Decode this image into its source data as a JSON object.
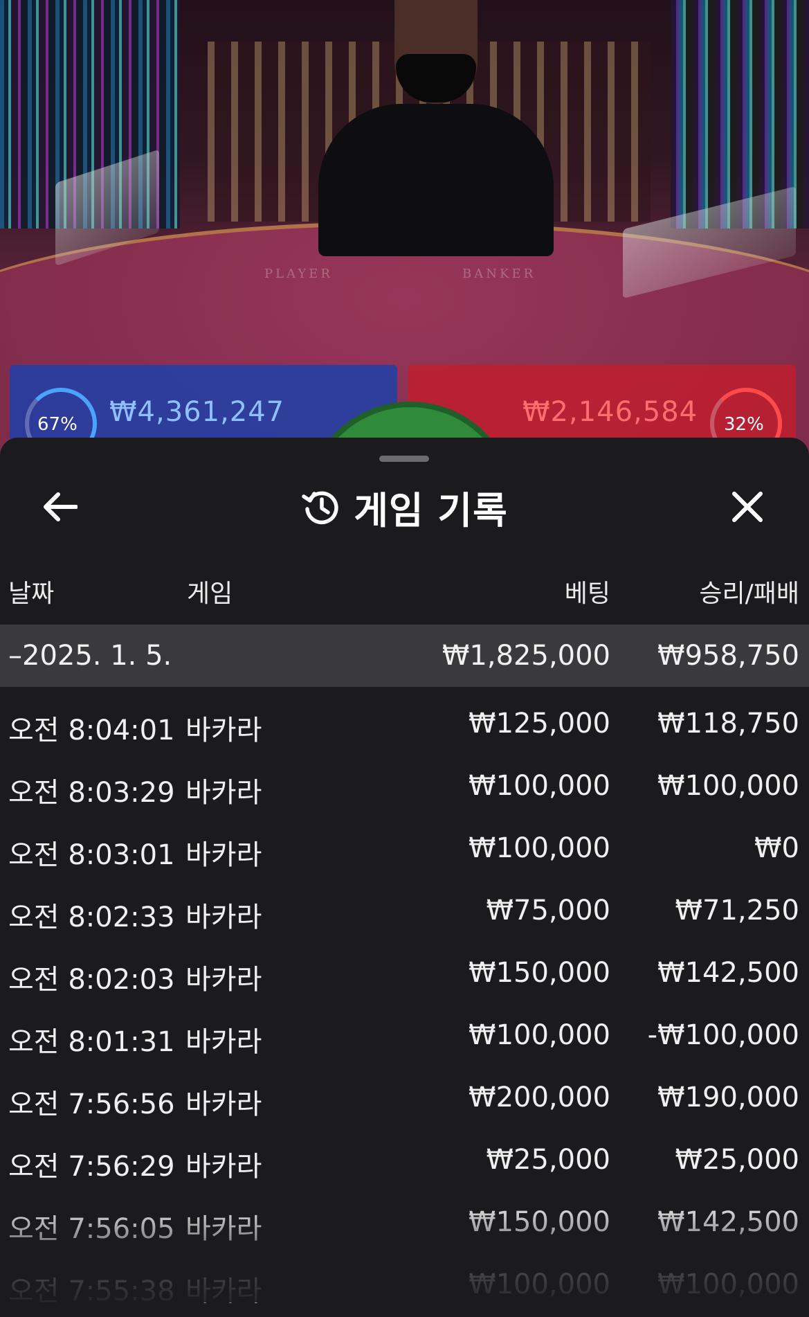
{
  "video": {
    "felt_player_text": "PLAYER",
    "felt_banker_text": "BANKER",
    "player": {
      "percent": "67%",
      "amount": "₩4,361,247"
    },
    "banker": {
      "percent": "32%",
      "amount": "₩2,146,584"
    }
  },
  "sheet": {
    "title": "게임 기록",
    "icons": {
      "back": "arrow-left-icon",
      "history": "history-icon",
      "close": "close-icon"
    }
  },
  "table": {
    "headers": {
      "date": "날짜",
      "game": "게임",
      "bet": "베팅",
      "result": "승리/패배"
    },
    "summary": {
      "date": "–2025. 1. 5.",
      "bet": "₩1,825,000",
      "result": "₩958,750"
    },
    "rows": [
      {
        "time": "오전 8:04:01",
        "game": "바카라",
        "bet": "₩125,000",
        "result": "₩118,750"
      },
      {
        "time": "오전 8:03:29",
        "game": "바카라",
        "bet": "₩100,000",
        "result": "₩100,000"
      },
      {
        "time": "오전 8:03:01",
        "game": "바카라",
        "bet": "₩100,000",
        "result": "₩0"
      },
      {
        "time": "오전 8:02:33",
        "game": "바카라",
        "bet": "₩75,000",
        "result": "₩71,250"
      },
      {
        "time": "오전 8:02:03",
        "game": "바카라",
        "bet": "₩150,000",
        "result": "₩142,500"
      },
      {
        "time": "오전 8:01:31",
        "game": "바카라",
        "bet": "₩100,000",
        "result": "-₩100,000"
      },
      {
        "time": "오전 7:56:56",
        "game": "바카라",
        "bet": "₩200,000",
        "result": "₩190,000"
      },
      {
        "time": "오전 7:56:29",
        "game": "바카라",
        "bet": "₩25,000",
        "result": "₩25,000"
      },
      {
        "time": "오전 7:56:05",
        "game": "바카라",
        "bet": "₩150,000",
        "result": "₩142,500"
      },
      {
        "time": "오전 7:55:38",
        "game": "바카라",
        "bet": "₩100,000",
        "result": "₩100,000"
      }
    ]
  }
}
